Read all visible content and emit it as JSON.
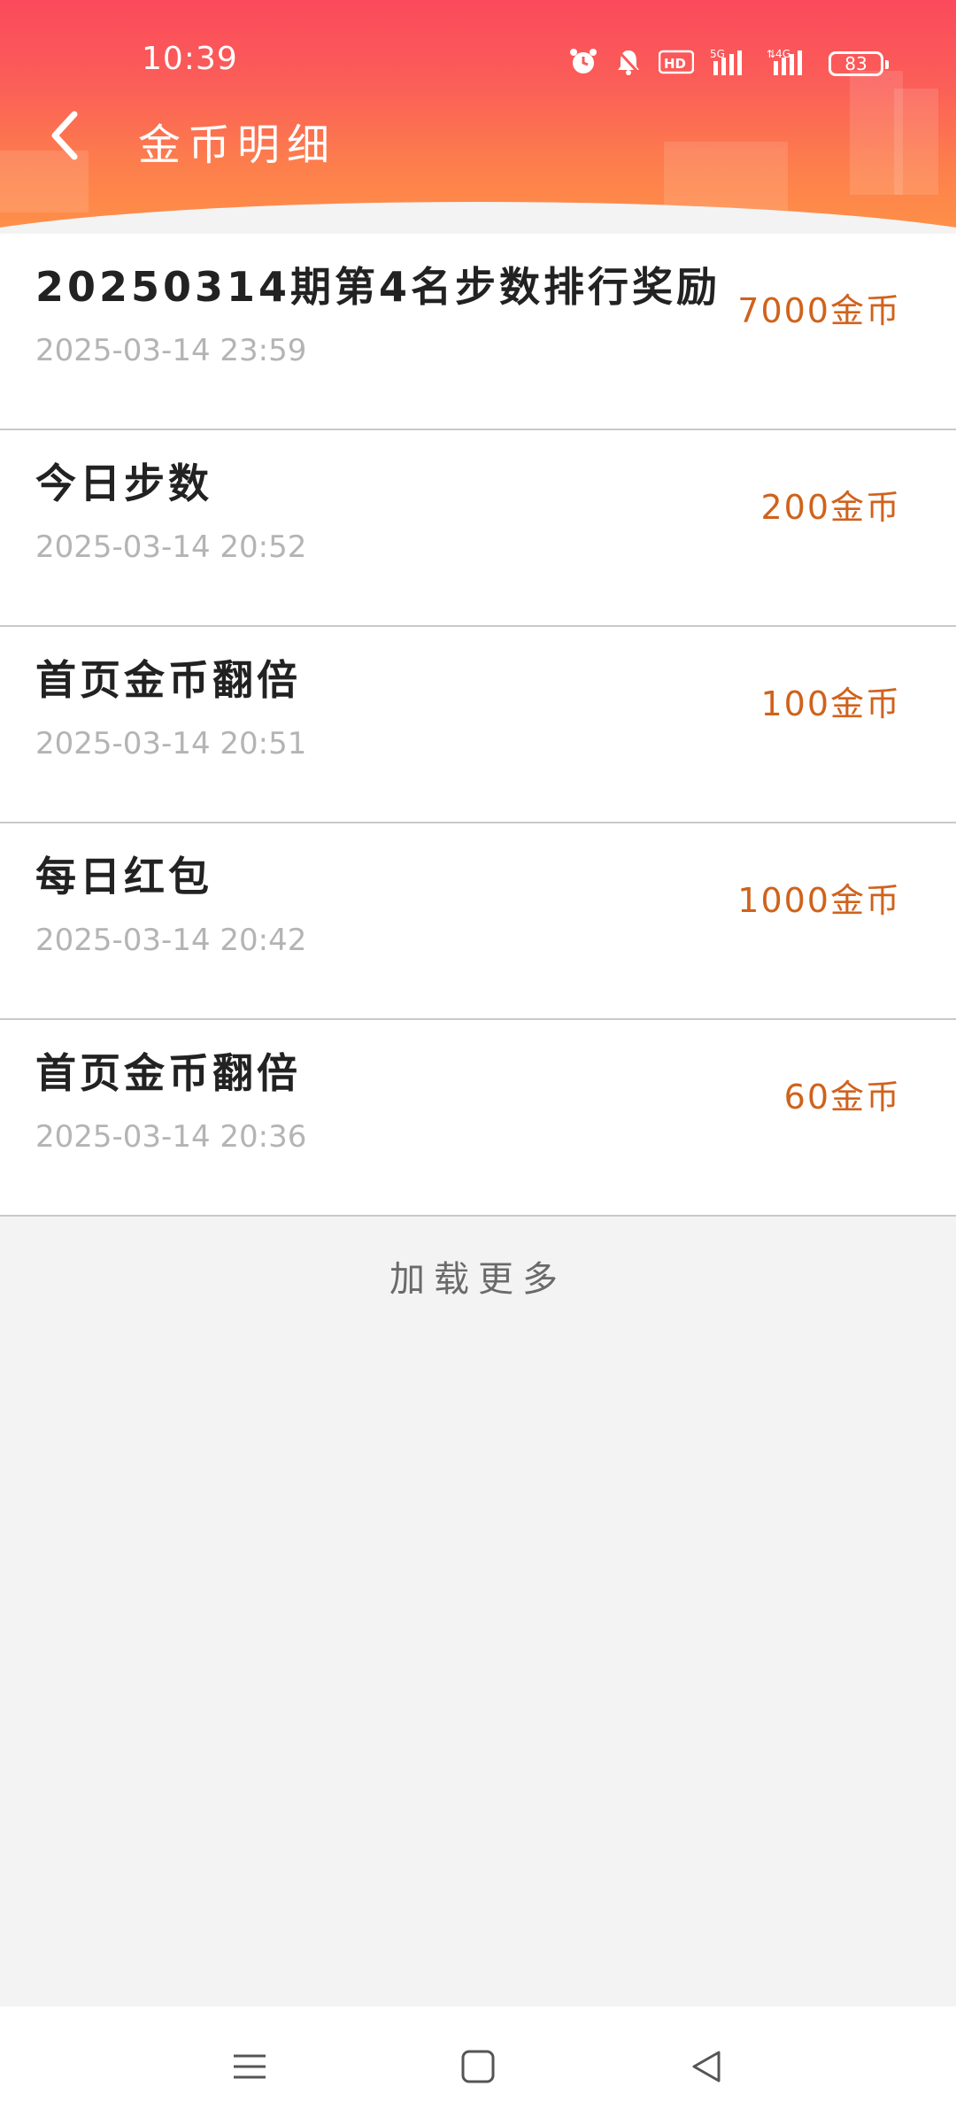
{
  "status_bar": {
    "time": "10:39",
    "battery": "83",
    "icons": [
      "alarm-icon",
      "mute-icon",
      "hd-icon",
      "signal-5g-icon",
      "signal-4g-icon",
      "battery-icon"
    ]
  },
  "header": {
    "title": "金币明细",
    "back_icon": "chevron-left-icon"
  },
  "records": [
    {
      "title": "20250314期第4名步数排行奖励",
      "time": "2025-03-14 23:59",
      "amount": "7000金币"
    },
    {
      "title": "今日步数",
      "time": "2025-03-14 20:52",
      "amount": "200金币"
    },
    {
      "title": "首页金币翻倍",
      "time": "2025-03-14 20:51",
      "amount": "100金币"
    },
    {
      "title": "每日红包",
      "time": "2025-03-14 20:42",
      "amount": "1000金币"
    },
    {
      "title": "首页金币翻倍",
      "time": "2025-03-14 20:36",
      "amount": "60金币"
    }
  ],
  "load_more": "加载更多",
  "colors": {
    "header_top": "#fb4a5c",
    "header_bottom": "#ff9248",
    "amount": "#d0621c",
    "background": "#f3f3f3"
  },
  "nav_bar": [
    "menu-icon",
    "home-icon",
    "back-triangle-icon"
  ]
}
